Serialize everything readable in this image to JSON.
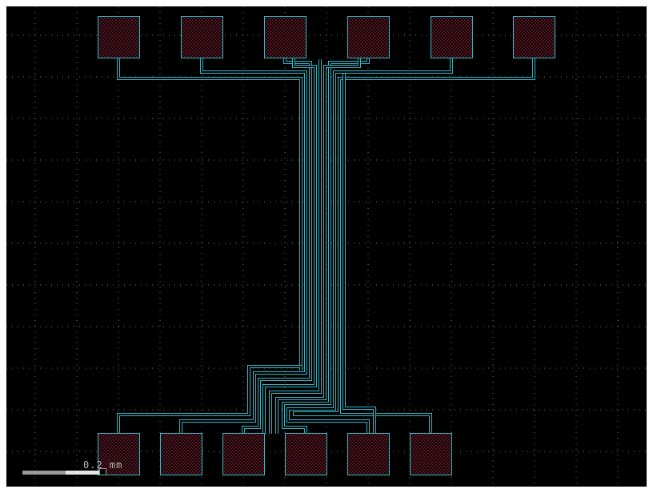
{
  "viewer": {
    "background_color": "#000000",
    "grid_color": "#c8c8c8",
    "trace_color": "#2fb8c8",
    "pad_outline_color": "#2fb8c8",
    "pad_fill_color": "#5a1a2a",
    "scale_label": "0.2 mm"
  },
  "layout": {
    "top_pads": 6,
    "bottom_pads": 6,
    "traces": 12
  }
}
